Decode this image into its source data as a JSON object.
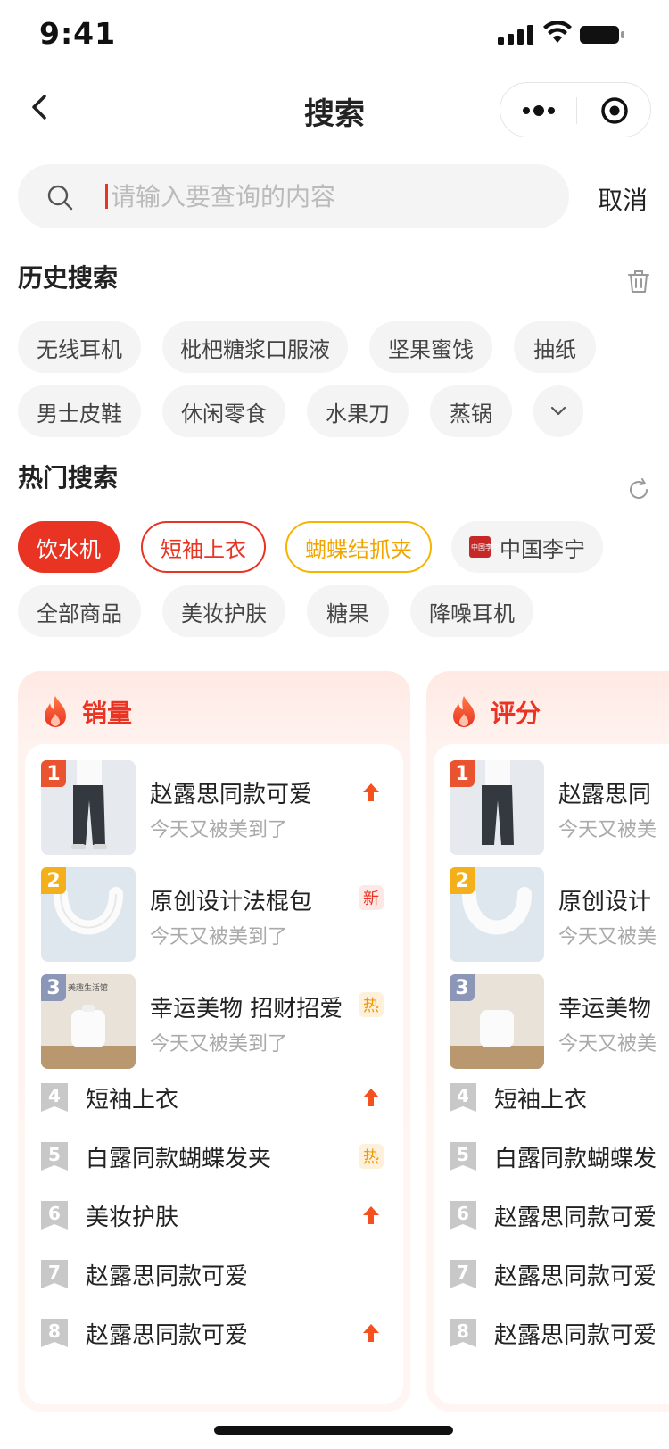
{
  "status": {
    "time": "9:41"
  },
  "nav": {
    "title": "搜索"
  },
  "search": {
    "placeholder": "请输入要查询的内容",
    "cancel": "取消"
  },
  "history": {
    "title": "历史搜索",
    "chips": [
      "无线耳机",
      "枇杷糖浆口服液",
      "坚果蜜饯",
      "抽纸",
      "男士皮鞋",
      "休闲零食",
      "水果刀",
      "蒸锅"
    ]
  },
  "hot": {
    "title": "热门搜索",
    "chips": [
      "饮水机",
      "短袖上衣",
      "蝴蝶结抓夹",
      "中国李宁",
      "全部商品",
      "美妆护肤",
      "糖果",
      "降噪耳机"
    ],
    "brand_logo": "中国李宁"
  },
  "rank_sales": {
    "title": "销量",
    "top": [
      {
        "rank": "1",
        "title": "赵露思同款可爱",
        "sub": "今天又被美到了",
        "tag": "up"
      },
      {
        "rank": "2",
        "title": "原创设计法棍包",
        "sub": "今天又被美到了",
        "tag": "新"
      },
      {
        "rank": "3",
        "title": "幸运美物 招财招爱",
        "sub": "今天又被美到了",
        "tag": "热"
      }
    ],
    "list": [
      {
        "rank": "4",
        "title": "短袖上衣",
        "tag": "up"
      },
      {
        "rank": "5",
        "title": "白露同款蝴蝶发夹",
        "tag": "热"
      },
      {
        "rank": "6",
        "title": "美妆护肤",
        "tag": "up"
      },
      {
        "rank": "7",
        "title": "赵露思同款可爱",
        "tag": ""
      },
      {
        "rank": "8",
        "title": "赵露思同款可爱",
        "tag": "up"
      }
    ]
  },
  "rank_score": {
    "title": "评分",
    "top": [
      {
        "rank": "1",
        "title": "赵露思同",
        "sub": "今天又被美"
      },
      {
        "rank": "2",
        "title": "原创设计",
        "sub": "今天又被美"
      },
      {
        "rank": "3",
        "title": "幸运美物",
        "sub": "今天又被美"
      }
    ],
    "list": [
      {
        "rank": "4",
        "title": "短袖上衣"
      },
      {
        "rank": "5",
        "title": "白露同款蝴蝶发"
      },
      {
        "rank": "6",
        "title": "赵露思同款可爱"
      },
      {
        "rank": "7",
        "title": "赵露思同款可爱"
      },
      {
        "rank": "8",
        "title": "赵露思同款可爱"
      }
    ]
  },
  "thumb_text": {
    "humidifier_label": "美趣生活馆"
  },
  "colors": {
    "accent": "#e93323",
    "orange": "#f5b400",
    "rank1": "#e9532f",
    "rank2": "#f3b01b",
    "rank3": "#8c97b8",
    "rank_other": "#c8c8c8"
  }
}
